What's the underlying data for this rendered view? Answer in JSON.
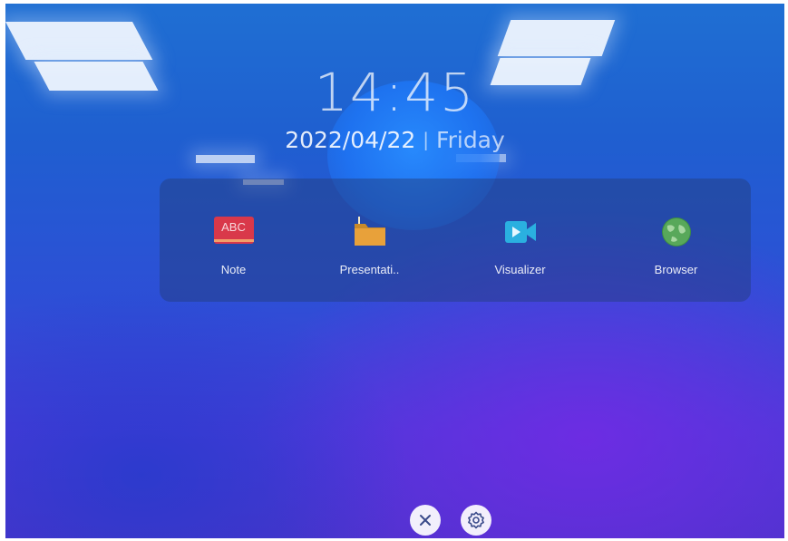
{
  "clock": {
    "time": "14:45",
    "date": "2022/04/22",
    "separator": "|",
    "weekday": "Friday"
  },
  "apps": [
    {
      "label": "Note",
      "icon": "note-abc-icon",
      "icon_text": "ABC",
      "color": "#d9384a"
    },
    {
      "label": "Presentati..",
      "icon": "folder-icon",
      "color": "#e8a13a"
    },
    {
      "label": "Visualizer",
      "icon": "video-camera-icon",
      "color": "#2ab0e0"
    },
    {
      "label": "Browser",
      "icon": "globe-icon",
      "color": "#4caf50"
    }
  ],
  "bottom_bar": {
    "close_icon": "close-icon",
    "settings_icon": "settings-gear-icon"
  }
}
